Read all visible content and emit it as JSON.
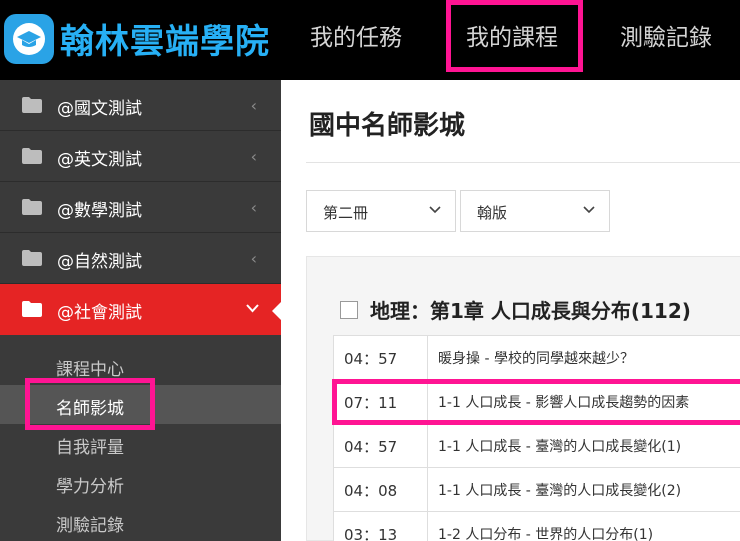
{
  "header": {
    "logo_text": "翰林雲端學院",
    "nav": {
      "tasks": "我的任務",
      "courses": "我的課程",
      "records": "測驗記錄"
    }
  },
  "sidebar": {
    "items": [
      {
        "label": "@國文測試"
      },
      {
        "label": "@英文測試"
      },
      {
        "label": "@數學測試"
      },
      {
        "label": "@自然測試"
      },
      {
        "label": "@社會測試"
      }
    ],
    "sub_items": [
      {
        "label": "課程中心"
      },
      {
        "label": "名師影城"
      },
      {
        "label": "自我評量"
      },
      {
        "label": "學力分析"
      },
      {
        "label": "測驗記錄"
      }
    ]
  },
  "main": {
    "title": "國中名師影城",
    "book_select": "第二冊",
    "version_select": "翰版",
    "chapter_title": "地理：第1章 人口成長與分布(112)",
    "lessons": [
      {
        "time": "04：57",
        "title": "暖身操 - 學校的同學越來越少？"
      },
      {
        "time": "07：11",
        "title": "1-1 人口成長 - 影響人口成長趨勢的因素"
      },
      {
        "time": "04：57",
        "title": "1-1 人口成長 - 臺灣的人口成長變化(1)"
      },
      {
        "time": "04：08",
        "title": "1-1 人口成長 - 臺灣的人口成長變化(2)"
      },
      {
        "time": "03：13",
        "title": "1-2 人口分布 - 世界的人口分布(1)"
      }
    ]
  },
  "colors": {
    "header_bg": "#000000",
    "logo_blue": "#27b0f5",
    "sidebar_bg": "#3a3a3a",
    "active_red": "#e52424",
    "highlight_pink": "#ff1493"
  }
}
